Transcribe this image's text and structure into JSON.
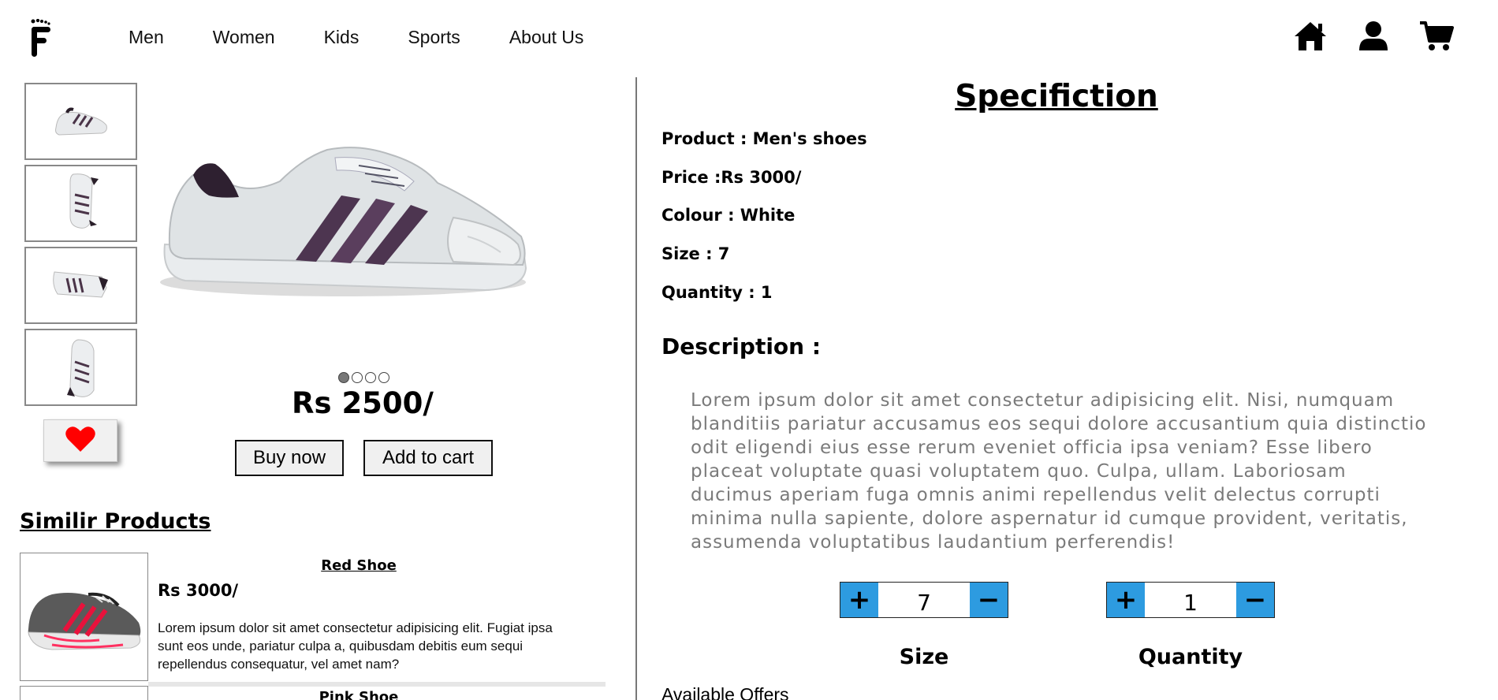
{
  "nav": {
    "items": [
      "Men",
      "Women",
      "Kids",
      "Sports",
      "About Us"
    ]
  },
  "header_icons": [
    "home-icon",
    "user-icon",
    "cart-icon"
  ],
  "gallery": {
    "thumbnails": [
      "shoe-side",
      "shoe-top",
      "shoe-back",
      "shoe-front"
    ],
    "active_dot": 0,
    "dot_count": 4
  },
  "product": {
    "price": "Rs 2500/",
    "buy_label": "Buy now",
    "cart_label": "Add to cart"
  },
  "similar": {
    "title": "Similir Products",
    "items": [
      {
        "name": "Red Shoe",
        "price": "Rs 3000/",
        "description": "Lorem ipsum dolor sit amet consectetur adipisicing elit. Fugiat ipsa sunt eos unde, pariatur culpa a, quibusdam debitis eum sequi repellendus consequatur, vel amet nam?"
      },
      {
        "name": "Pink Shoe"
      }
    ]
  },
  "spec": {
    "title": "Specifiction",
    "rows": [
      "Product : Men's shoes",
      "Price :Rs 3000/",
      "Colour : White",
      "Size : 7",
      "Quantity : 1"
    ],
    "description_title": "Description :",
    "description_text": "Lorem ipsum dolor sit amet consectetur adipisicing elit. Nisi, numquam blanditiis pariatur accusamus eos sequi dolore accusantium quia distinctio odit eligendi eius esse rerum eveniet officia ipsa veniam? Esse libero placeat voluptate quasi voluptatem quo. Culpa, ullam. Laboriosam ducimus aperiam fuga omnis animi repellendus velit delectus corrupti minima nulla sapiente, dolore aspernatur id cumque provident, veritatis, assumenda voluptatibus laudantium perferendis!"
  },
  "steppers": {
    "plus": "+",
    "minus": "−",
    "size": {
      "value": "7",
      "label": "Size"
    },
    "quantity": {
      "value": "1",
      "label": "Quantity"
    }
  },
  "offers_label": "Available Offers",
  "colors": {
    "stepper_accent": "#2d9be0",
    "heart": "#ff0000",
    "description_text": "#7a7a7a"
  }
}
